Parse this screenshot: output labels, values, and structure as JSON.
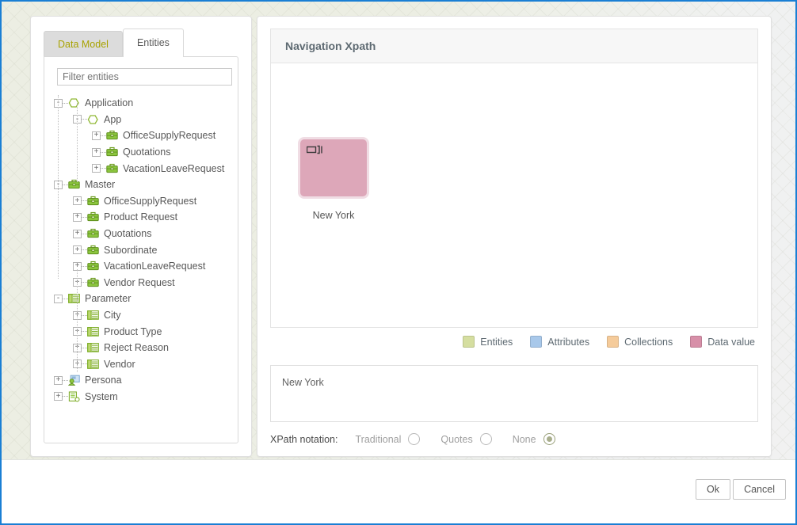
{
  "window": {
    "accent_border": "#1a7fd4"
  },
  "left_panel": {
    "tabs": [
      {
        "label": "Data Model",
        "active": false
      },
      {
        "label": "Entities",
        "active": true
      }
    ],
    "filter": {
      "placeholder": "Filter entities",
      "value": ""
    },
    "tree": [
      {
        "label": "Application",
        "icon": "hexagon-icon",
        "toggle": "-",
        "depth": 0
      },
      {
        "label": "App",
        "icon": "hexagon-icon",
        "toggle": "-",
        "depth": 1
      },
      {
        "label": "OfficeSupplyRequest",
        "icon": "briefcase-icon",
        "toggle": "+",
        "depth": 2
      },
      {
        "label": "Quotations",
        "icon": "briefcase-icon",
        "toggle": "+",
        "depth": 2
      },
      {
        "label": "VacationLeaveRequest",
        "icon": "briefcase-icon",
        "toggle": "+",
        "depth": 2
      },
      {
        "label": "Master",
        "icon": "briefcase-icon",
        "toggle": "-",
        "depth": 0
      },
      {
        "label": "OfficeSupplyRequest",
        "icon": "briefcase-icon",
        "toggle": "+",
        "depth": 1
      },
      {
        "label": "Product Request",
        "icon": "briefcase-icon",
        "toggle": "+",
        "depth": 1
      },
      {
        "label": "Quotations",
        "icon": "briefcase-icon",
        "toggle": "+",
        "depth": 1
      },
      {
        "label": "Subordinate",
        "icon": "briefcase-icon",
        "toggle": "+",
        "depth": 1
      },
      {
        "label": "VacationLeaveRequest",
        "icon": "briefcase-icon",
        "toggle": "+",
        "depth": 1
      },
      {
        "label": "Vendor Request",
        "icon": "briefcase-icon",
        "toggle": "+",
        "depth": 1
      },
      {
        "label": "Parameter",
        "icon": "grid-icon",
        "toggle": "-",
        "depth": 0
      },
      {
        "label": "City",
        "icon": "grid-icon",
        "toggle": "+",
        "depth": 1
      },
      {
        "label": "Product Type",
        "icon": "grid-icon",
        "toggle": "+",
        "depth": 1
      },
      {
        "label": "Reject Reason",
        "icon": "grid-icon",
        "toggle": "+",
        "depth": 1
      },
      {
        "label": "Vendor",
        "icon": "grid-icon",
        "toggle": "+",
        "depth": 1
      },
      {
        "label": "Persona",
        "icon": "persona-icon",
        "toggle": "+",
        "depth": 0
      },
      {
        "label": "System",
        "icon": "system-icon",
        "toggle": "+",
        "depth": 0
      }
    ]
  },
  "right_panel": {
    "title": "Navigation Xpath",
    "canvas": {
      "nodes": [
        {
          "label": "New York",
          "type": "data-value",
          "color": "#dda7b9",
          "glyph": "data-value-icon"
        }
      ]
    },
    "legend": [
      {
        "label": "Entities",
        "color": "#d5dea0"
      },
      {
        "label": "Attributes",
        "color": "#a8c8ea"
      },
      {
        "label": "Collections",
        "color": "#f5cb9a"
      },
      {
        "label": "Data value",
        "color": "#d78fa8"
      }
    ],
    "xpath_value": "New York",
    "notation": {
      "label": "XPath notation:",
      "options": [
        {
          "label": "Traditional",
          "selected": false
        },
        {
          "label": "Quotes",
          "selected": false
        },
        {
          "label": "None",
          "selected": true
        }
      ]
    }
  },
  "footer": {
    "ok_label": "Ok",
    "cancel_label": "Cancel"
  }
}
